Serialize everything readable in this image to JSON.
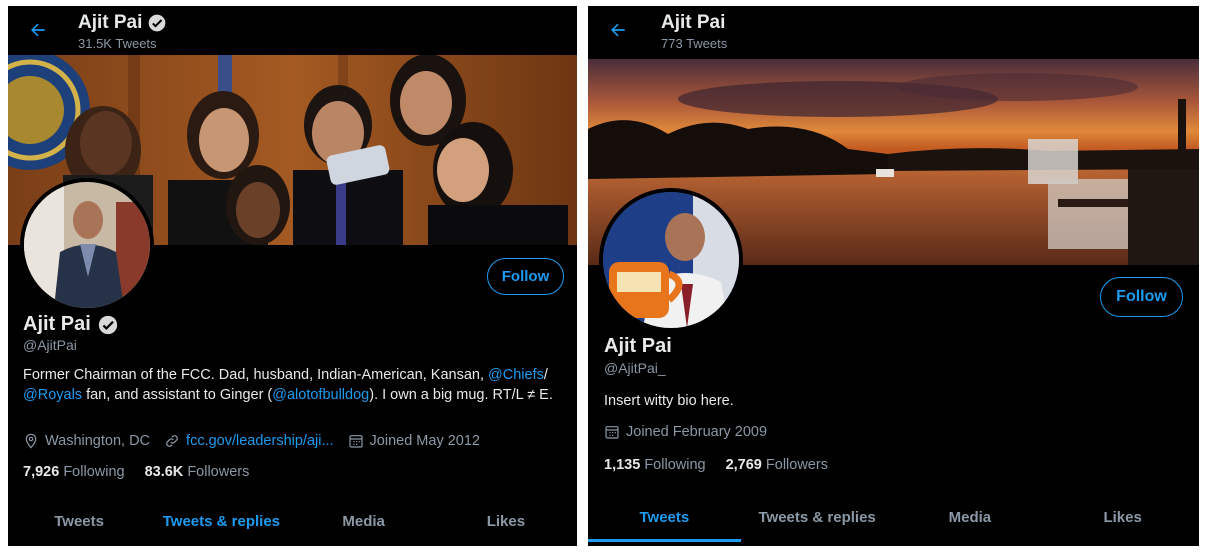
{
  "left": {
    "header": {
      "name": "Ajit Pai",
      "tweets_count": "31.5K Tweets"
    },
    "follow_label": "Follow",
    "name": "Ajit Pai",
    "handle": "@AjitPai",
    "bio": {
      "part1": "Former Chairman of the FCC. Dad, husband, Indian-American, Kansan, ",
      "mention1": "@Chiefs",
      "part2": "/ ",
      "mention2": "@Royals",
      "part3": " fan, and assistant to Ginger (",
      "mention3": "@alotofbulldog",
      "part4": "). I own a big mug. RT/L ≠ E."
    },
    "location": "Washington, DC",
    "website": "fcc.gov/leadership/aji...",
    "joined": "Joined May 2012",
    "following_count": "7,926",
    "following_label": "Following",
    "followers_count": "83.6K",
    "followers_label": "Followers",
    "tabs": [
      "Tweets",
      "Tweets & replies",
      "Media",
      "Likes"
    ],
    "active_tab": 1
  },
  "right": {
    "header": {
      "name": "Ajit Pai",
      "tweets_count": "773 Tweets"
    },
    "follow_label": "Follow",
    "name": "Ajit Pai",
    "handle": "@AjitPai_",
    "bio": "Insert witty bio here.",
    "joined": "Joined February 2009",
    "following_count": "1,135",
    "following_label": "Following",
    "followers_count": "2,769",
    "followers_label": "Followers",
    "tabs": [
      "Tweets",
      "Tweets & replies",
      "Media",
      "Likes"
    ],
    "active_tab": 0
  },
  "colors": {
    "accent": "#1d9bf0",
    "background": "#000000",
    "muted": "#8b98a5"
  }
}
